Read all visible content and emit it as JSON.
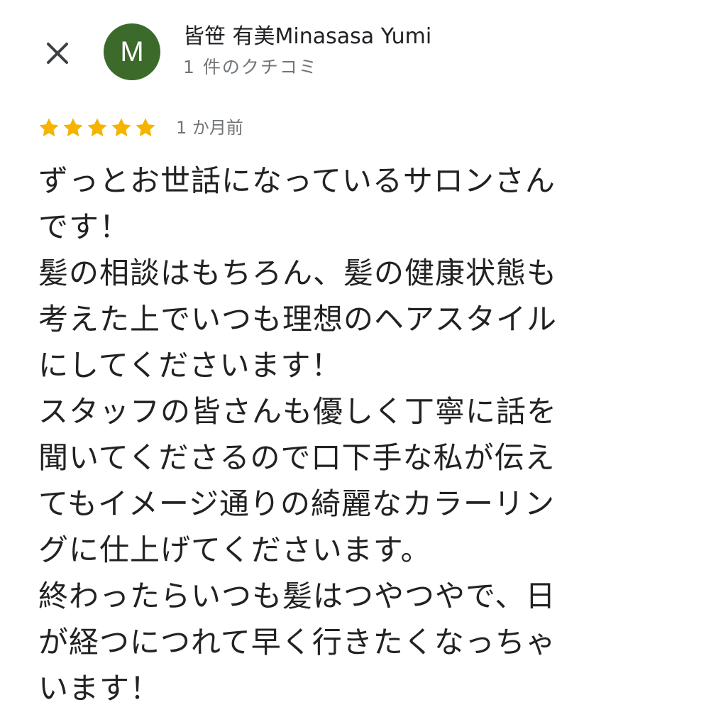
{
  "header": {
    "close_icon": "close-icon",
    "avatar_letter": "M",
    "avatar_color": "#3b6a2b",
    "reviewer_name": "皆笹 有美Minasasa Yumi",
    "review_count": "1 件のクチコミ"
  },
  "rating": {
    "stars": 5,
    "max_stars": 5,
    "star_color": "#f4b400",
    "date": "1 か月前"
  },
  "review": {
    "lines": [
      "ずっとお世話になっているサロンさん",
      "です！",
      "髪の相談はもちろん、髪の健康状態も",
      "考えた上でいつも理想のヘアスタイル",
      "にしてくださいます！",
      "スタッフの皆さんも優しく丁寧に話を",
      "聞いてくださるので口下手な私が伝え",
      "てもイメージ通りの綺麗なカラーリン",
      "グに仕上げてくださいます。",
      "終わったらいつも髪はつやつやで、日",
      "が経つにつれて早く行きたくなっちゃ",
      "います！"
    ]
  }
}
